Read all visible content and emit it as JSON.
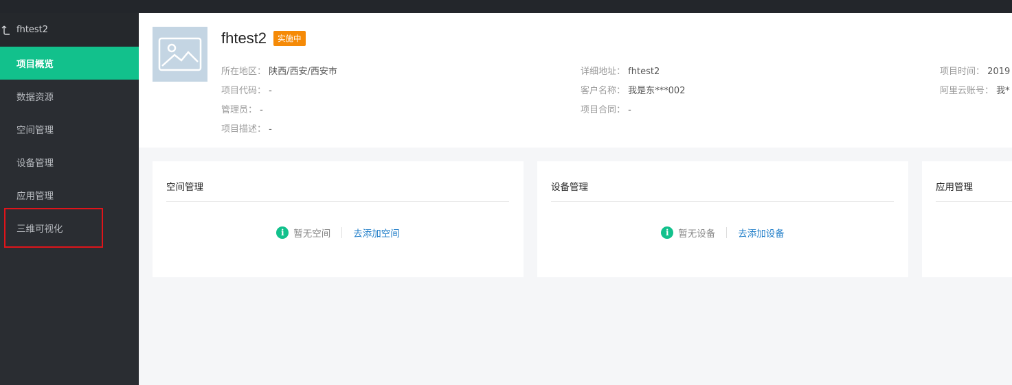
{
  "sidebar": {
    "back_label": "fhtest2",
    "items": [
      {
        "label": "项目概览"
      },
      {
        "label": "数据资源"
      },
      {
        "label": "空间管理"
      },
      {
        "label": "设备管理"
      },
      {
        "label": "应用管理"
      },
      {
        "label": "三维可视化"
      }
    ]
  },
  "project": {
    "title": "fhtest2",
    "status": "实施中",
    "fields": {
      "region_label": "所在地区：",
      "region_value": "陕西/西安/西安市",
      "code_label": "项目代码：",
      "code_value": "-",
      "admin_label": "管理员：",
      "admin_value": "-",
      "desc_label": "项目描述：",
      "desc_value": "-",
      "address_label": "详细地址：",
      "address_value": "fhtest2",
      "customer_label": "客户名称：",
      "customer_value": "我是东***002",
      "contract_label": "项目合同：",
      "contract_value": "-",
      "time_label": "项目时间：",
      "time_value": "2019",
      "aliyun_label": "阿里云账号：",
      "aliyun_value": "我*"
    }
  },
  "cards": [
    {
      "title": "空间管理",
      "empty_text": "暂无空间",
      "action": "去添加空间"
    },
    {
      "title": "设备管理",
      "empty_text": "暂无设备",
      "action": "去添加设备"
    },
    {
      "title": "应用管理"
    }
  ],
  "colors": {
    "accent": "#12c18c",
    "badge": "#f58a07",
    "link": "#1f7dc8",
    "sidebar_bg": "#2a2d32",
    "highlight": "#e0141a"
  },
  "icons": {
    "back": "return-arrow-icon",
    "thumbnail": "image-placeholder-icon",
    "empty": "info-circle-icon"
  }
}
